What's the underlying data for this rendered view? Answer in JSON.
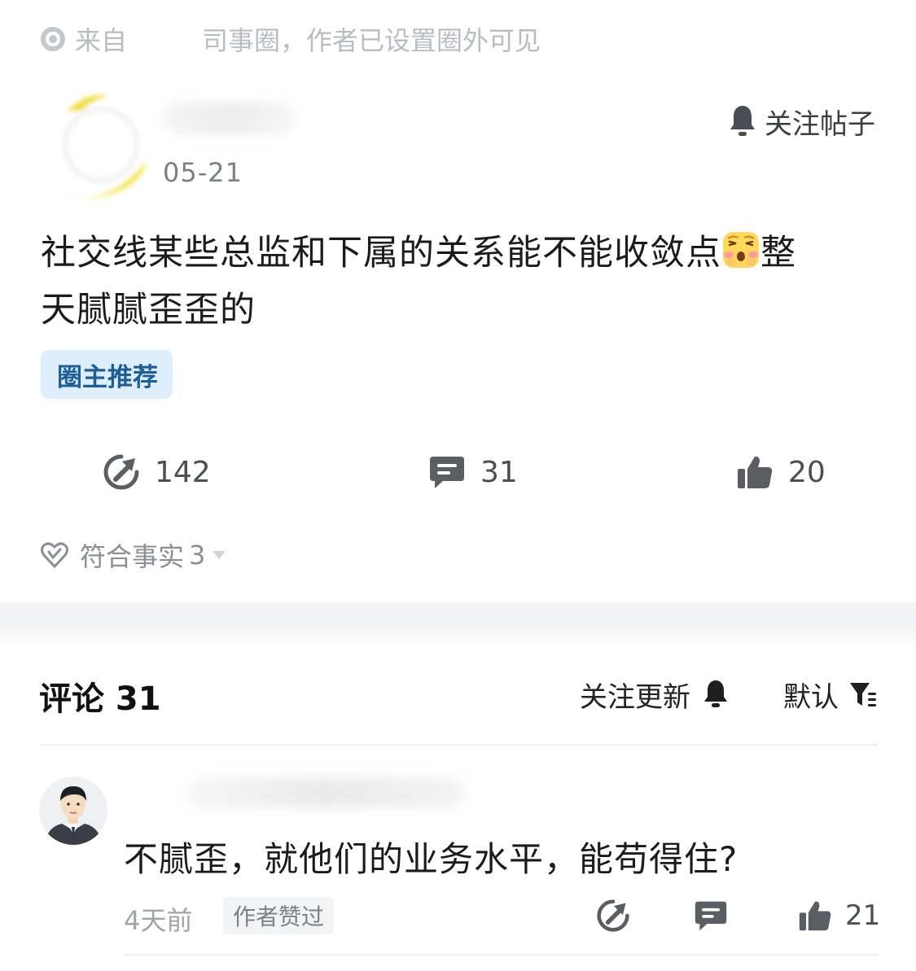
{
  "post": {
    "source_prefix": "来自",
    "source_suffix": "司事圈，作者已设置圈外可见",
    "date": "05-21",
    "follow_label": "关注帖子",
    "body_part1": "社交线某些总监和下属的关系能不能收敛点",
    "body_part2": "整",
    "body_line2": "天腻腻歪歪的",
    "tag": "圈主推荐",
    "share_count": "142",
    "comment_count": "31",
    "like_count": "20",
    "fact_label": "符合事实",
    "fact_count": "3",
    "emoji": "flustered-face-emoji"
  },
  "comments_section": {
    "title": "评论 31",
    "follow_updates": "关注更新",
    "sort_label": "默认"
  },
  "comment": {
    "text": "不腻歪，就他们的业务水平，能苟得住?",
    "time": "4天前",
    "author_liked": "作者赞过",
    "like_count": "21"
  },
  "icons": [
    "target-circle-icon",
    "bell-icon",
    "share-arrow-icon",
    "comment-bubble-icon",
    "thumbs-up-icon",
    "heart-badge-icon",
    "caret-down-icon",
    "filter-icon"
  ],
  "colors": {
    "tag_bg": "#dfeefc",
    "tag_text": "#1d5f96",
    "muted": "#a0a4ab",
    "icon_gray": "#555a60"
  }
}
